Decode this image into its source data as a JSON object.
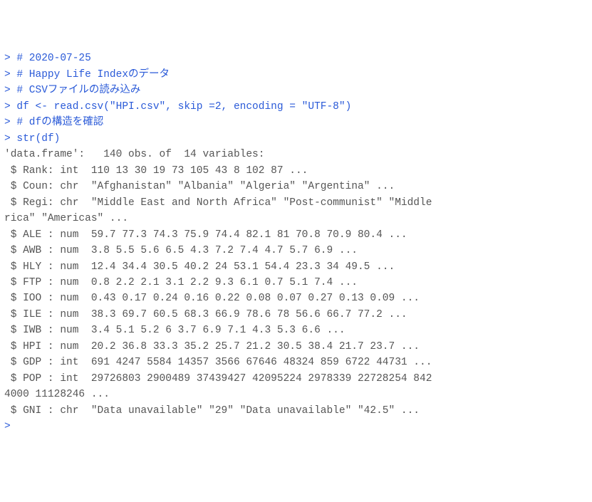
{
  "console": {
    "prompt": "> ",
    "input_lines": [
      "# 2020-07-25",
      "# Happy Life Indexのデータ",
      "# CSVファイルの読み込み",
      "df <- read.csv(\"HPI.csv\", skip =2, encoding = \"UTF-8\")",
      "# dfの構造を確認",
      "str(df)"
    ],
    "output_lines": [
      "'data.frame':   140 obs. of  14 variables:",
      " $ Rank: int  110 13 30 19 73 105 43 8 102 87 ...",
      " $ Coun: chr  \"Afghanistan\" \"Albania\" \"Algeria\" \"Argentina\" ...",
      " $ Regi: chr  \"Middle East and North Africa\" \"Post-communist\" \"Middle",
      "rica\" \"Americas\" ...",
      " $ ALE : num  59.7 77.3 74.3 75.9 74.4 82.1 81 70.8 70.9 80.4 ...",
      " $ AWB : num  3.8 5.5 5.6 6.5 4.3 7.2 7.4 4.7 5.7 6.9 ...",
      " $ HLY : num  12.4 34.4 30.5 40.2 24 53.1 54.4 23.3 34 49.5 ...",
      " $ FTP : num  0.8 2.2 2.1 3.1 2.2 9.3 6.1 0.7 5.1 7.4 ...",
      " $ IOO : num  0.43 0.17 0.24 0.16 0.22 0.08 0.07 0.27 0.13 0.09 ...",
      " $ ILE : num  38.3 69.7 60.5 68.3 66.9 78.6 78 56.6 66.7 77.2 ...",
      " $ IWB : num  3.4 5.1 5.2 6 3.7 6.9 7.1 4.3 5.3 6.6 ...",
      " $ HPI : num  20.2 36.8 33.3 35.2 25.7 21.2 30.5 38.4 21.7 23.7 ...",
      " $ GDP : int  691 4247 5584 14357 3566 67646 48324 859 6722 44731 ...",
      " $ POP : int  29726803 2900489 37439427 42095224 2978339 22728254 842",
      "4000 11128246 ...",
      " $ GNI : chr  \"Data unavailable\" \"29\" \"Data unavailable\" \"42.5\" ..."
    ],
    "final_prompt": "> "
  }
}
